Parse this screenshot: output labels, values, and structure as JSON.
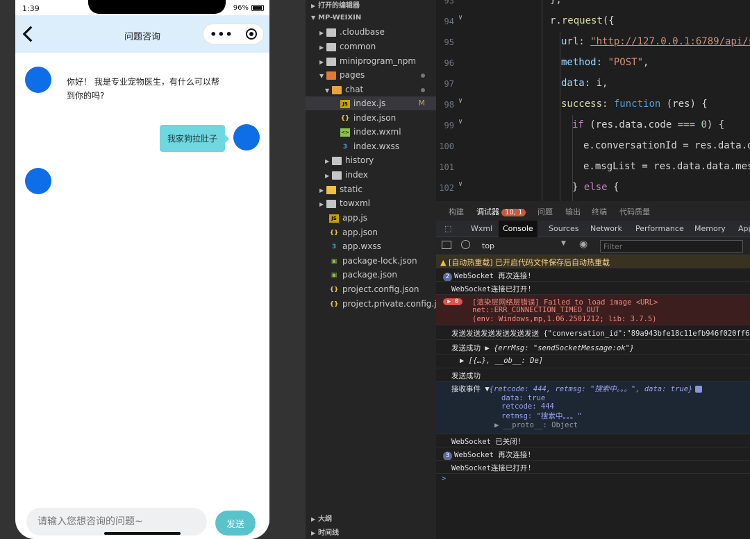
{
  "phone": {
    "status_time": "1:39",
    "battery": "96%",
    "nav_title": "问题咨询",
    "bot_message": "你好！ 我是专业宠物医生，有什么可以帮到你的吗?",
    "user_message": "我家狗拉肚子",
    "input_placeholder": "请输入您想咨询的问题~",
    "send_label": "发送"
  },
  "explorer": {
    "open_editors": "打开的编辑器",
    "project": "MP-WEIXIN",
    "items": [
      {
        "label": ".cloudbase"
      },
      {
        "label": "common"
      },
      {
        "label": "miniprogram_npm"
      },
      {
        "label": "pages"
      },
      {
        "label": "chat"
      },
      {
        "label": "index.js",
        "badge": "M"
      },
      {
        "label": "index.json"
      },
      {
        "label": "index.wxml"
      },
      {
        "label": "index.wxss"
      },
      {
        "label": "history"
      },
      {
        "label": "index"
      },
      {
        "label": "static"
      },
      {
        "label": "towxml"
      },
      {
        "label": "app.js"
      },
      {
        "label": "app.json"
      },
      {
        "label": "app.wxss"
      },
      {
        "label": "package-lock.json"
      },
      {
        "label": "package.json"
      },
      {
        "label": "project.config.json"
      },
      {
        "label": "project.private.config.js..."
      }
    ],
    "outline": "大纲",
    "timeline": "时间线"
  },
  "editor": {
    "line_numbers": [
      "93",
      "94",
      "95",
      "96",
      "97",
      "98",
      "99",
      "100",
      "101",
      "102"
    ],
    "lines": {
      "l93": "};",
      "l94_obj": "r.",
      "l94_fn": "request",
      "l94_rest": "({",
      "l95_key": "url",
      "l95_sep": ": ",
      "l95_str": "\"http://127.0.0.1:6789/api/s",
      "l96_key": "method",
      "l96_sep": ": ",
      "l96_str": "\"POST\"",
      "l96_end": ",",
      "l97_key": "data",
      "l97_rest": ": i,",
      "l98_key": "success",
      "l98_sep": ": ",
      "l98_kw": "function",
      "l98_rest": " (res) {",
      "l99_kw": "if",
      "l99_rest": " (res.data.code === ",
      "l99_num": "0",
      "l99_end": ") {",
      "l100": "e.conversationId = res.data.d",
      "l101": "e.msgList = res.data.data.mes",
      "l102_pre": "} ",
      "l102_kw": "else",
      "l102_end": " {"
    }
  },
  "panel": {
    "tabs": [
      "构建",
      "调试器",
      "问题",
      "输出",
      "终端",
      "代码质量"
    ],
    "debugger_badge": "10, 1",
    "devtools_tabs": [
      "Wxml",
      "Console",
      "Sources",
      "Network",
      "Performance",
      "Memory",
      "App"
    ],
    "context": "top",
    "filter_placeholder": "Filter"
  },
  "console": {
    "warn": "[自动热重载] 已开启代码文件保存后自动热重载",
    "r1_count": "2",
    "r1": "WebSocket 再次连接!",
    "r2": "WebSocket连接已打开!",
    "err_badge": "▶ 0",
    "err1": "[渲染层网络层错误] Failed to load image <URL>",
    "err2": "net::ERR_CONNECTION_TIMED_OUT",
    "err3": "(env: Windows,mp,1.06.2501212; lib: 3.7.5)",
    "r3": "发送发送发送发送发送发送 {\"conversation_id\":\"89a943bfe18c11efb946f020ff6",
    "r4_pre": "发送成功 ▶ ",
    "r4_obj": "{errMsg: \"sendSocketMessage:ok\"}",
    "r5": "▶ [{…}, __ob__: De]",
    "r6": "发送成功",
    "r7_pre": "接收事件 ▼",
    "r7_obj": "{retcode: 444, retmsg: \"搜索中。。。\", data: true}",
    "r8": "data: true",
    "r9": "retcode: 444",
    "r10": "retmsg: \"搜索中。。。\"",
    "r11": "▶ __proto__: Object",
    "r12": "WebSocket 已关闭!",
    "r13_count": "3",
    "r13": "WebSocket 再次连接!",
    "r14": "WebSocket连接已打开!",
    "prompt": ">"
  }
}
